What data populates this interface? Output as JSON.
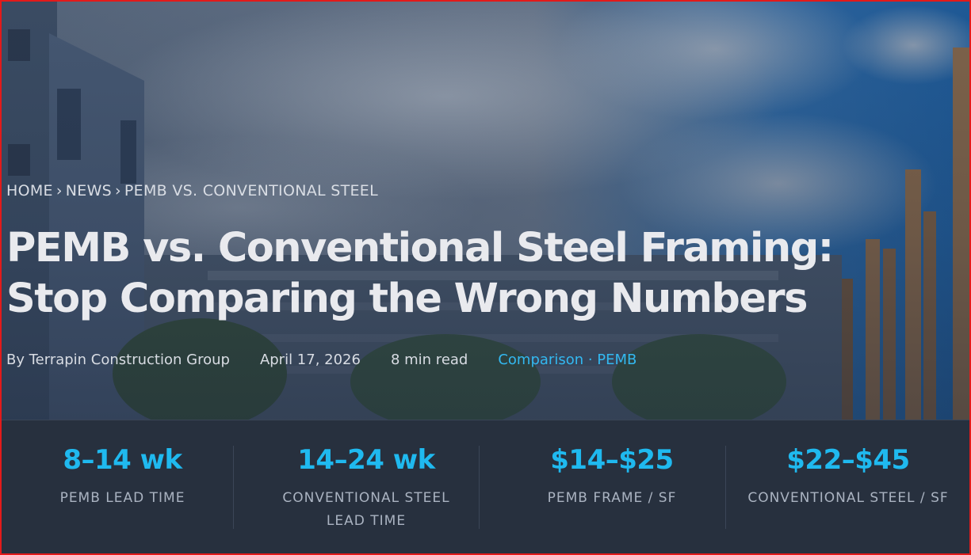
{
  "breadcrumb": {
    "home": "HOME",
    "news": "NEWS",
    "current": "PEMB VS. CONVENTIONAL STEEL",
    "separator": "›"
  },
  "article": {
    "title": "PEMB vs. Conventional Steel Framing: Stop Comparing the Wrong Numbers",
    "author": "By Terrapin Construction Group",
    "date": "April 17, 2026",
    "read_time": "8 min read",
    "categories": "Comparison · PEMB"
  },
  "stats": [
    {
      "value": "8–14 wk",
      "label": "PEMB LEAD TIME"
    },
    {
      "value": "14–24 wk",
      "label": "CONVENTIONAL STEEL LEAD TIME"
    },
    {
      "value": "$14–$25",
      "label": "PEMB FRAME / SF"
    },
    {
      "value": "$22–$45",
      "label": "CONVENTIONAL STEEL / SF"
    }
  ],
  "colors": {
    "accent": "#1fb9ef",
    "stats_background": "#27303e",
    "frame_border": "#e31a1a"
  }
}
